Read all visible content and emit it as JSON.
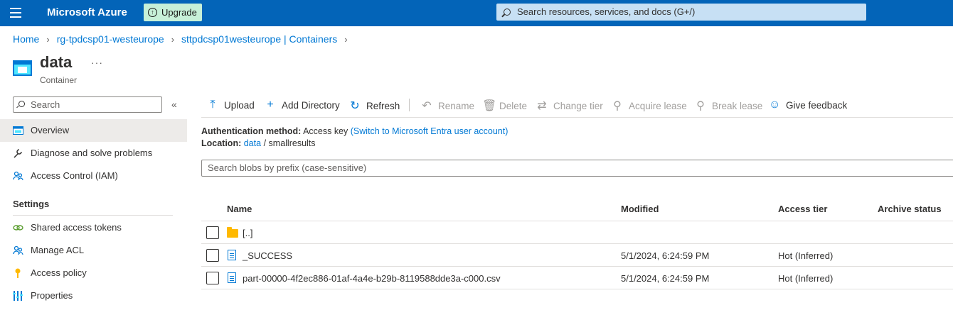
{
  "topbar": {
    "brand": "Microsoft Azure",
    "upgrade_label": "Upgrade",
    "search_placeholder": "Search resources, services, and docs (G+/)"
  },
  "breadcrumb": [
    "Home",
    "rg-tpdcsp01-westeurope",
    "sttpdcsp01westeurope | Containers"
  ],
  "page": {
    "title": "data",
    "subtitle": "Container",
    "more": "···"
  },
  "nav": {
    "search_placeholder": "Search",
    "collapse": "«",
    "items_top": [
      {
        "label": "Overview",
        "icon": "overview-icon"
      },
      {
        "label": "Diagnose and solve problems",
        "icon": "wrench-icon"
      },
      {
        "label": "Access Control (IAM)",
        "icon": "people-icon"
      }
    ],
    "section_settings": "Settings",
    "items_settings": [
      {
        "label": "Shared access tokens",
        "icon": "link-icon"
      },
      {
        "label": "Manage ACL",
        "icon": "people-icon"
      },
      {
        "label": "Access policy",
        "icon": "key-icon"
      },
      {
        "label": "Properties",
        "icon": "properties-icon"
      }
    ]
  },
  "toolbar": {
    "upload": "Upload",
    "add_directory": "Add Directory",
    "refresh": "Refresh",
    "rename": "Rename",
    "delete": "Delete",
    "change_tier": "Change tier",
    "acquire_lease": "Acquire lease",
    "break_lease": "Break lease",
    "give_feedback": "Give feedback"
  },
  "info": {
    "auth_label": "Authentication method:",
    "auth_value": "Access key",
    "auth_link": "(Switch to Microsoft Entra user account)",
    "location_label": "Location:",
    "location_link": "data",
    "location_sep": "/",
    "location_rest": "smallresults"
  },
  "blob_search_placeholder": "Search blobs by prefix (case-sensitive)",
  "table": {
    "headers": {
      "name": "Name",
      "modified": "Modified",
      "access_tier": "Access tier",
      "archive_status": "Archive status"
    },
    "rows": [
      {
        "name": "[..]",
        "modified": "",
        "access_tier": "",
        "type": "folder"
      },
      {
        "name": "_SUCCESS",
        "modified": "5/1/2024, 6:24:59 PM",
        "access_tier": "Hot (Inferred)",
        "type": "file"
      },
      {
        "name": "part-00000-4f2ec886-01af-4a4e-b29b-8119588dde3a-c000.csv",
        "modified": "5/1/2024, 6:24:59 PM",
        "access_tier": "Hot (Inferred)",
        "type": "file"
      }
    ]
  }
}
